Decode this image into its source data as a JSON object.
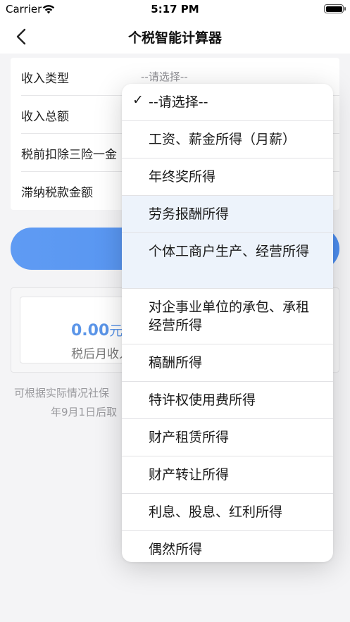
{
  "status_bar": {
    "carrier": "Carrier",
    "time": "5:17 PM"
  },
  "nav": {
    "title": "个税智能计算器"
  },
  "form": {
    "rows": [
      {
        "label": "收入类型",
        "value": "--请选择--"
      },
      {
        "label": "收入总额",
        "value": ""
      },
      {
        "label": "税前扣除三险一金",
        "value": ""
      },
      {
        "label": "滞纳税款金额",
        "value": ""
      }
    ]
  },
  "result": {
    "value": "0.00",
    "unit": "元",
    "label": "税后月收入"
  },
  "note": {
    "line1": "可根据实际情况社保",
    "line2": "年9月1日后取"
  },
  "dropdown": {
    "selected_index": 0,
    "options": [
      "--请选择--",
      "工资、薪金所得（月薪）",
      "年终奖所得",
      "劳务报酬所得",
      "个体工商户生产、经营所得",
      "对企事业单位的承包、承租经营所得",
      "稿酬所得",
      "特许权使用费所得",
      "财产租赁所得",
      "财产转让所得",
      "利息、股息、红利所得",
      "偶然所得"
    ]
  },
  "icons": {
    "back": "chevron-left-icon",
    "wifi": "wifi-icon",
    "battery": "battery-icon",
    "check": "checkmark-icon"
  },
  "colors": {
    "accent": "#5b95e8",
    "button": "#5f9bf3",
    "highlight": "#edf3fb"
  }
}
